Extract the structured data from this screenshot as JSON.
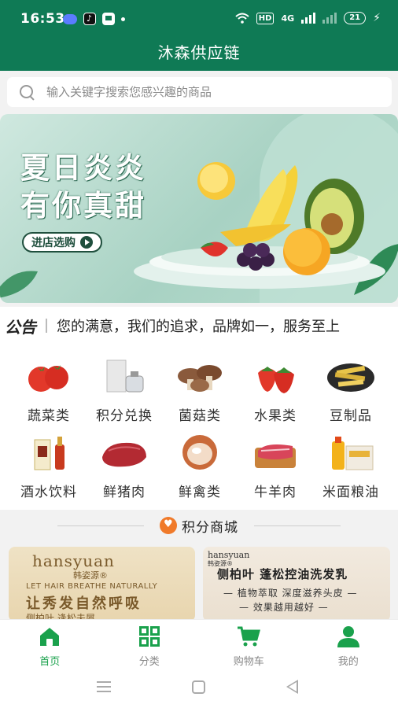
{
  "status_bar": {
    "time": "16:53",
    "hd": "HD",
    "network": "4G",
    "battery": "21"
  },
  "header": {
    "title": "沐森供应链"
  },
  "search": {
    "placeholder": "输入关键字搜索您感兴趣的商品"
  },
  "banner": {
    "line1": "夏日炎炎",
    "line2": "有你真甜",
    "button": "进店选购"
  },
  "notice": {
    "tag": "公告",
    "text": "您的满意，我们的追求，品牌如一，服务至上"
  },
  "categories": [
    {
      "label": "蔬菜类",
      "icon": "tomato-icon"
    },
    {
      "label": "积分兑换",
      "icon": "perfume-icon"
    },
    {
      "label": "菌菇类",
      "icon": "mushroom-icon"
    },
    {
      "label": "水果类",
      "icon": "strawberry-icon"
    },
    {
      "label": "豆制品",
      "icon": "tofu-icon"
    },
    {
      "label": "酒水饮料",
      "icon": "liquor-bottle-icon"
    },
    {
      "label": "鲜猪肉",
      "icon": "pork-icon"
    },
    {
      "label": "鲜禽类",
      "icon": "chicken-icon"
    },
    {
      "label": "牛羊肉",
      "icon": "beef-icon"
    },
    {
      "label": "米面粮油",
      "icon": "rice-oil-icon"
    }
  ],
  "points": {
    "title": "积分商城"
  },
  "promos": {
    "left": {
      "brand": "hansyuan",
      "brand_cn": "韩姿源®",
      "tagline_en": "LET HAIR BREATHE NATURALLY",
      "tagline_cn": "让秀发自然呼吸",
      "cut": "侧柏叶 逢松夫屑"
    },
    "right": {
      "brand": "hansyuan",
      "brand_cn": "韩姿源®",
      "title": "侧柏叶 蓬松控油洗发乳",
      "line1": "— 植物萃取 深度滋养头皮 —",
      "line2": "— 效果越用越好 —"
    }
  },
  "tabbar": [
    {
      "label": "首页",
      "active": true
    },
    {
      "label": "分类",
      "active": false
    },
    {
      "label": "购物车",
      "active": false
    },
    {
      "label": "我的",
      "active": false
    }
  ],
  "colors": {
    "primary": "#0f7a55",
    "tab_active": "#1aa14c",
    "accent_orange": "#f07a2a"
  }
}
